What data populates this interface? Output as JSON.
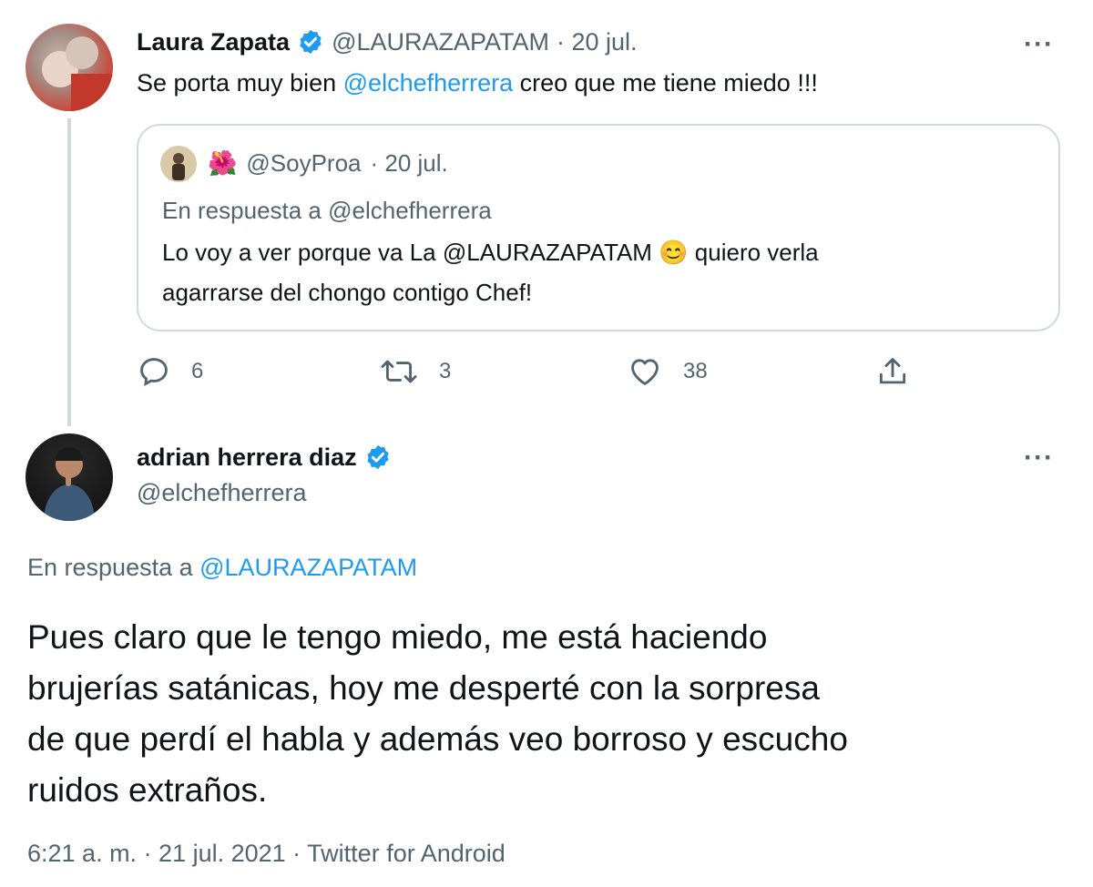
{
  "tweet1": {
    "name": "Laura Zapata",
    "handle": "@LAURAZAPATAM",
    "date": "· 20 jul.",
    "more": "···",
    "text_before": "Se porta muy bien ",
    "mention": "@elchefherrera",
    "text_after": " creo que me tiene miedo !!!",
    "quote": {
      "flower": "🌺",
      "handle": "@SoyProa",
      "date": "· 20 jul.",
      "reply_to": "En respuesta a @elchefherrera",
      "line1": "Lo voy a ver porque va La @LAURAZAPATAM",
      "emoji": "😊",
      "line1_end": " quiero verla",
      "line2": "agarrarse del chongo contigo Chef!"
    },
    "actions": {
      "replies": "6",
      "retweets": "3",
      "likes": "38"
    }
  },
  "tweet2": {
    "name": "adrian herrera diaz",
    "handle": "@elchefherrera",
    "more": "···",
    "reply_prefix": "En respuesta a ",
    "reply_mention": "@LAURAZAPATAM",
    "body_lines": [
      "Pues claro que le tengo miedo, me está haciendo",
      "brujerías satánicas, hoy me desperté con la sorpresa",
      "de que perdí el habla y además veo borroso y escucho",
      "ruidos extraños."
    ],
    "meta": "6:21 a. m. · 21 jul. 2021 · Twitter for Android"
  },
  "colors": {
    "link": "#1d9bf0",
    "gray": "#536471",
    "border": "#cfd9de",
    "verified": "#1d9bf0"
  }
}
